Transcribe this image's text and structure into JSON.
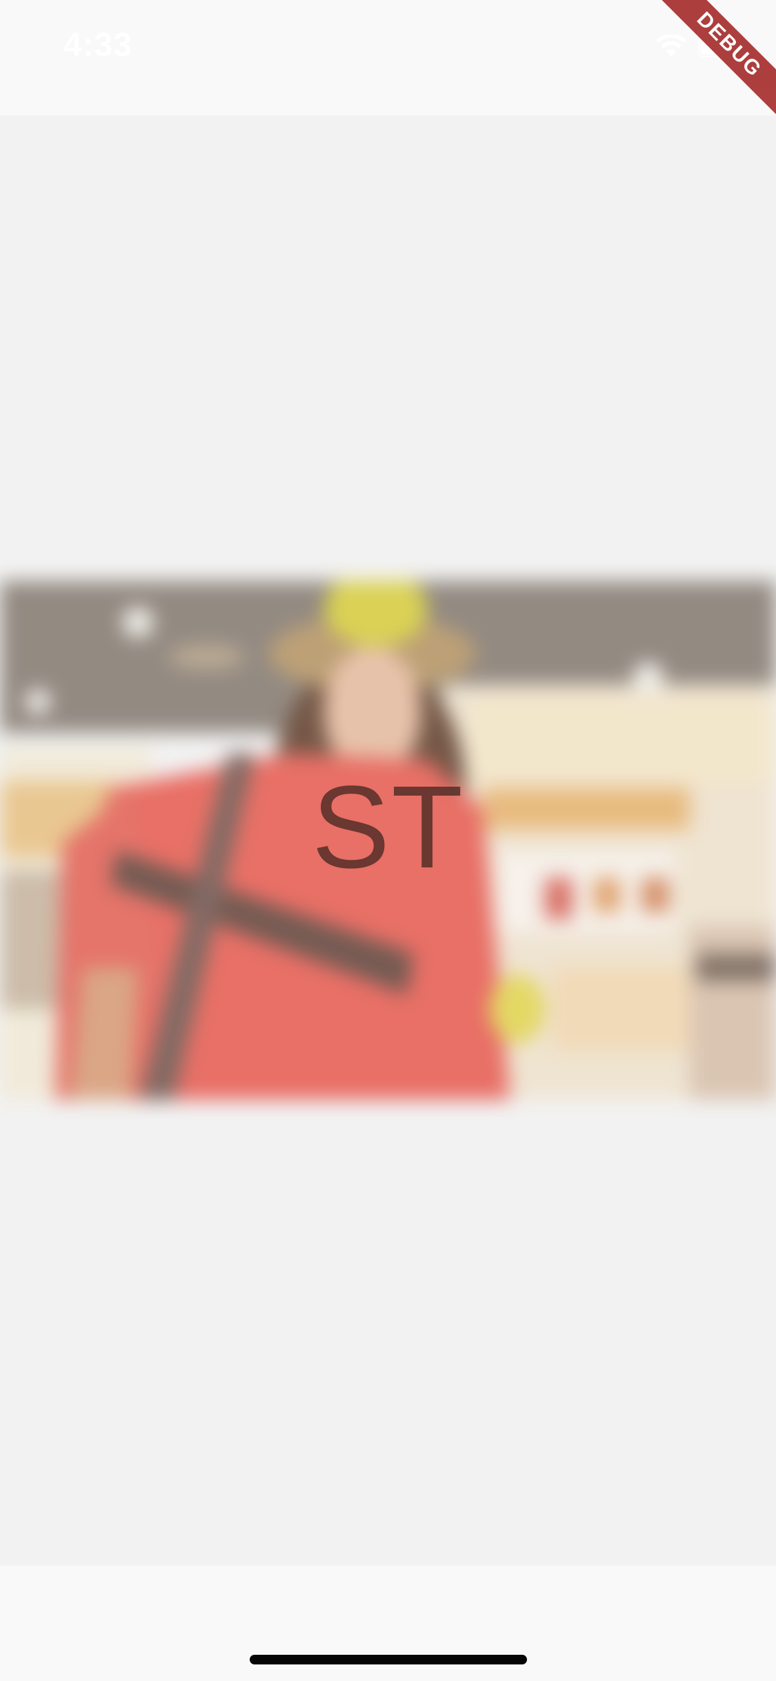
{
  "status_bar": {
    "time": "4:33",
    "wifi_icon": "wifi-icon",
    "battery_icon": "battery-icon"
  },
  "debug_banner": {
    "label": "DEBUG",
    "color": "#a52a2a"
  },
  "profile": {
    "initials": "ST",
    "photo_icon": "blurred-photo"
  },
  "colors": {
    "background": "#f2f2f2",
    "bars": "#f9f9f9",
    "home_indicator": "#050505"
  }
}
